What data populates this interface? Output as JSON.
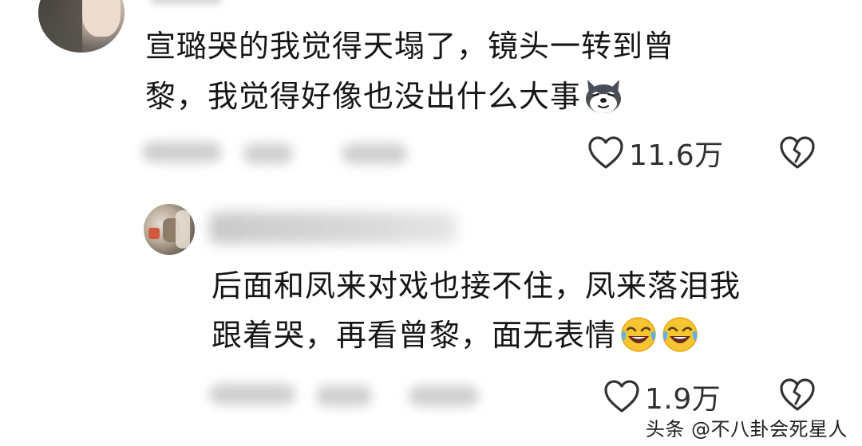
{
  "comments": [
    {
      "line1": "宣璐哭的我觉得天塌了，镜头一转到曾",
      "line2": "黎，我觉得好像也没出什么大事",
      "emoji": "dog-face-emoji",
      "like_count": "11.6万"
    },
    {
      "line1": "后面和凤来对戏也接不住，凤来落泪我",
      "line2": "跟着哭，再看曾黎，面无表情",
      "emoji": "rolling-laughing-emoji",
      "like_count": "1.9万"
    }
  ],
  "watermark": "头条 @不八卦会死星人",
  "colors": {
    "text": "#161616",
    "icon": "#333333",
    "blur": "#cfcfcf",
    "laugh_emoji": "#f7c531"
  }
}
